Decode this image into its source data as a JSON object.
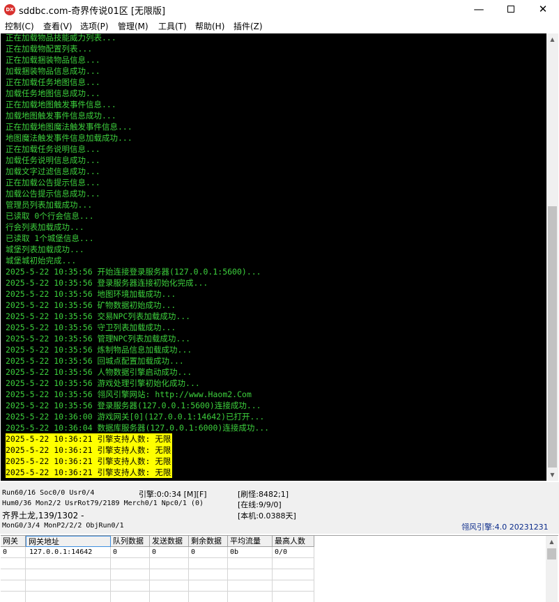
{
  "window": {
    "title": "sddbc.com-奇界传说01区 [无限版]",
    "icon_label": "DX",
    "minimize": "—",
    "close": "✕"
  },
  "menu": [
    "控制(C)",
    "查看(V)",
    "选项(P)",
    "管理(M)",
    "工具(T)",
    "帮助(H)",
    "插件(Z)"
  ],
  "console": {
    "lines": [
      "正在加载物品技能威力列表...",
      "正在加载物配置列表...",
      "正在加载捆装物品信息...",
      "加载捆装物品信息成功...",
      "正在加载任务地图信息...",
      "加载任务地图信息成功...",
      "正在加载地图触发事件信息...",
      "加载地图触发事件信息成功...",
      "正在加载地图魔法触发事件信息...",
      "地图魔法触发事件信息加载成功...",
      "正在加载任务说明信息...",
      "加载任务说明信息成功...",
      "加载文字过滤信息成功...",
      "正在加载公告提示信息...",
      "加载公告提示信息成功...",
      "管理员列表加载成功...",
      "已读取 0个行会信息...",
      "行会列表加载成功...",
      "已读取 1个城堡信息...",
      "城堡列表加载成功...",
      "城堡城初始完成...",
      "2025-5-22 10:35:56 开始连接登录服务器(127.0.0.1:5600)...",
      "2025-5-22 10:35:56 登录服务器连接初始化完成...",
      "2025-5-22 10:35:56 地图环境加载成功...",
      "2025-5-22 10:35:56 矿物数据初始成功...",
      "2025-5-22 10:35:56 交易NPC列表加载成功...",
      "2025-5-22 10:35:56 守卫列表加载成功...",
      "2025-5-22 10:35:56 管理NPC列表加载成功...",
      "2025-5-22 10:35:56 炼制物品信息加载成功...",
      "2025-5-22 10:35:56 回城点配置加载成功...",
      "2025-5-22 10:35:56 人物数据引擎启动成功...",
      "2025-5-22 10:35:56 游戏处理引擎初始化成功...",
      "2025-5-22 10:35:56 翎风引擎网站: http://www.Haom2.Com",
      "2025-5-22 10:35:56 登录服务器(127.0.0.1:5600)连接成功...",
      "2025-5-22 10:36:00 游戏网关[0](127.0.0.1:14642)已打开...",
      "2025-5-22 10:36:04 数据库服务器(127.0.0.1:6000)连接成功..."
    ],
    "highlighted": [
      "2025-5-22 10:36:21 引擎支持人数: 无限",
      "2025-5-22 10:36:21 引擎支持人数: 无限",
      "2025-5-22 10:36:21 引擎支持人数: 无限",
      "2025-5-22 10:36:21 引擎支持人数: 无限"
    ]
  },
  "status": {
    "run": "Run60/16 Soc0/0 Usr0/4",
    "engine_time": "引擎:0:0:34 [M][F]",
    "refresh": "[刷怪:8482;1]",
    "hum": "Hum0/36 Mon2/2 UsrRot79/2189 Merch0/1 Npc0/1 (0)",
    "online": "[在线:9/9/0]",
    "monster": "齐界土龙,139/1302 -",
    "local": "[本机:0.0388天]",
    "mong": "MonG0/3/4 MonP2/2/2 ObjRun0/1",
    "engine_version": "翎风引擎:4.0 20231231"
  },
  "gateway_grid": {
    "headers": [
      "网关",
      "网关地址",
      "队列数据",
      "发送数据",
      "剩余数据",
      "平均流量",
      "最高人数"
    ],
    "rows": [
      [
        "0",
        "127.0.0.1:14642",
        "0",
        "0",
        "0",
        "0b",
        "0/0"
      ]
    ]
  }
}
